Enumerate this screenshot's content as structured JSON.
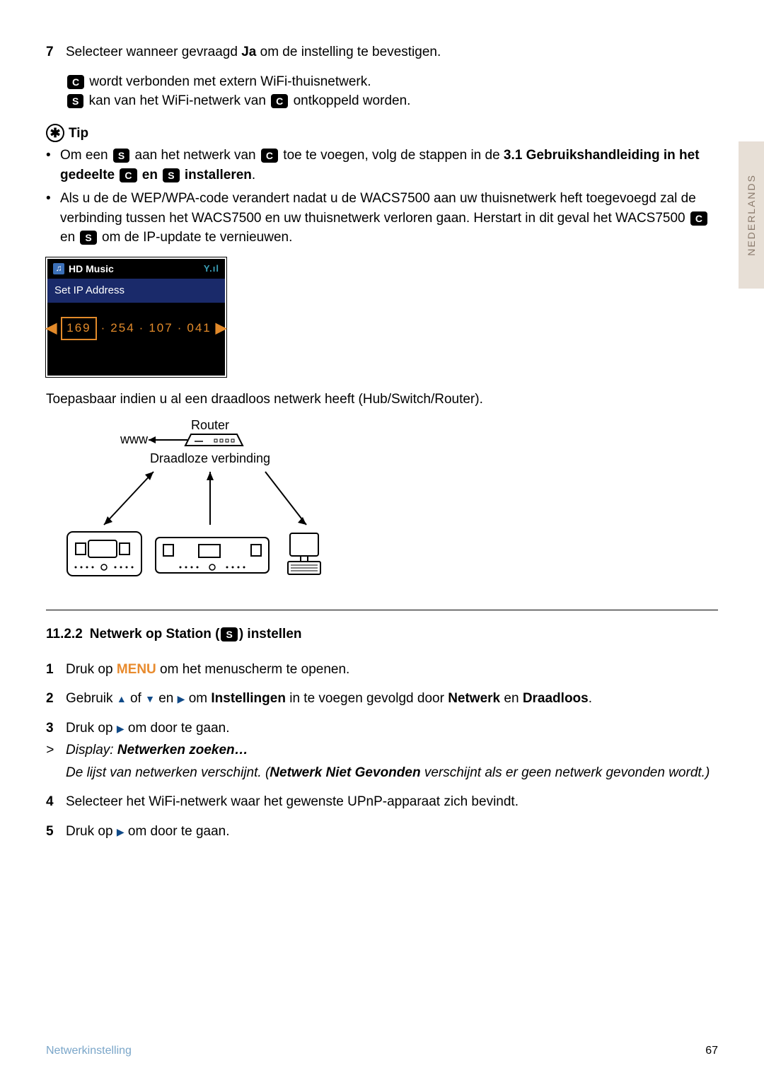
{
  "side_tab": "NEDERLANDS",
  "step7": {
    "num": "7",
    "t1": "Selecteer wanneer gevraagd ",
    "t1b": "Ja",
    "t2": " om de instelling te bevestigen."
  },
  "badge_c": "C",
  "badge_s": "S",
  "line_c": " wordt verbonden met extern WiFi-thuisnetwerk.",
  "line_s1": " kan van het WiFi-netwerk van ",
  "line_s2": " ontkoppeld worden.",
  "tip_label": "Tip",
  "tip1": {
    "a": "Om een ",
    "b": " aan het netwerk van ",
    "c": " toe te voegen, volg de stappen in de ",
    "d": "3.1 Gebruikshandleiding in het gedeelte ",
    "e": " en ",
    "f": " installeren",
    "g": "."
  },
  "tip2": {
    "a": "Als u de de WEP/WPA-code verandert nadat u de WACS7500 aan uw thuisnetwerk heft toegevoegd zal de verbinding tussen het WACS7500 en uw thuisnetwerk verloren gaan. Herstart in dit geval het WACS7500 ",
    "b": " en ",
    "c": " om de IP-update te vernieuwen."
  },
  "device": {
    "hd": "HD Music",
    "signal": "Y.ıl",
    "title": "Set IP Address",
    "ip1": "169",
    "ip2": "254",
    "ip3": "107",
    "ip4": "041"
  },
  "para_applicable": "Toepasbaar indien u al een draadloos netwerk heeft (Hub/Switch/Router).",
  "diagram": {
    "router": "Router",
    "www": "www",
    "wireless": "Draadloze verbinding"
  },
  "section": {
    "num": "11.2.2",
    "t1": "Netwerk op Station (",
    "t2": ") instellen"
  },
  "steps": {
    "s1": {
      "n": "1",
      "a": "Druk op ",
      "menu": "MENU",
      "b": " om het menuscherm te openen."
    },
    "s2": {
      "n": "2",
      "a": "Gebruik ",
      "b": " of ",
      "c": " en ",
      "d": " om ",
      "inst": "Instellingen",
      "e": " in te voegen gevolgd door ",
      "net": "Netwerk",
      "f": " en ",
      "draad": "Draadloos",
      "g": "."
    },
    "s3": {
      "n": "3",
      "a": "Druk op ",
      "b": " om door te gaan."
    },
    "disp1": {
      "gt": ">",
      "a": "Display: ",
      "b": "Netwerken zoeken…"
    },
    "disp2": {
      "a": "De lijst van netwerken verschijnt. (",
      "b": "Netwerk Niet Gevonden",
      "c": " verschijnt als er geen netwerk gevonden wordt.)"
    },
    "s4": {
      "n": "4",
      "a": "Selecteer het WiFi-netwerk waar het gewenste UPnP-apparaat zich bevindt."
    },
    "s5": {
      "n": "5",
      "a": "Druk op ",
      "b": " om door te gaan."
    }
  },
  "footer": {
    "left": "Netwerkinstelling",
    "right": "67"
  }
}
